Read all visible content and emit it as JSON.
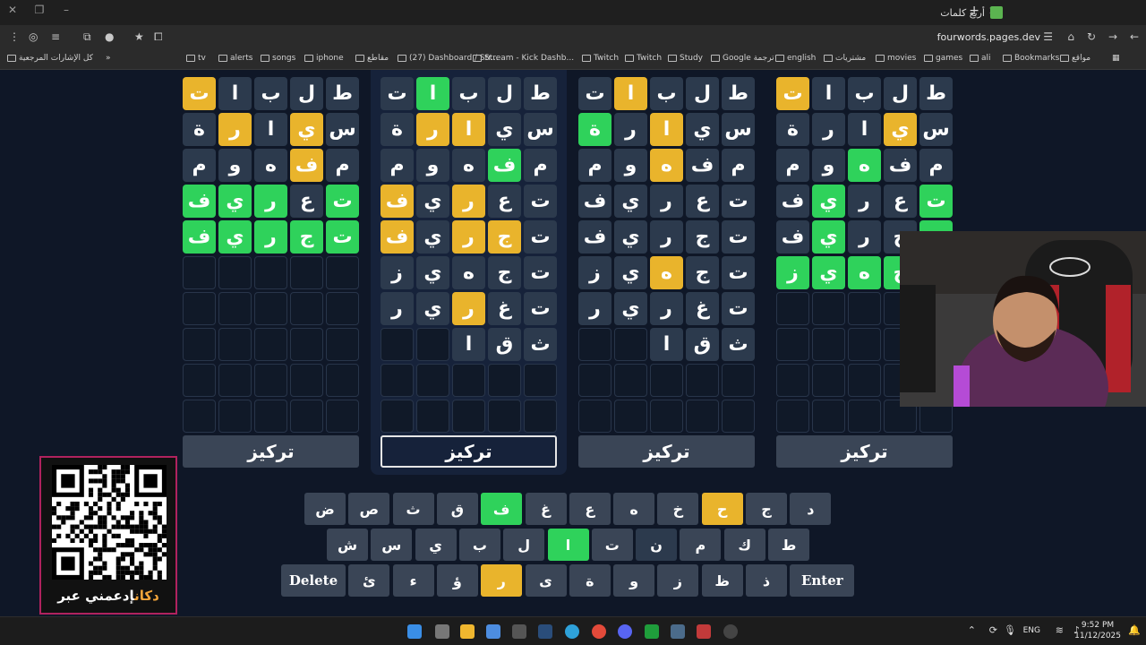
{
  "browser": {
    "tab_title": "أربع كلمات",
    "url": "fourwords.pages.dev",
    "bookmarks": [
      "كل الإشارات المرجعية",
      "tv",
      "alerts",
      "songs",
      "iphone",
      "مقاطع",
      "(27) Dashboard / Str...",
      "Stream - Kick Dashb...",
      "Twitch",
      "Twitch",
      "Study",
      "Google ترجمة",
      "english",
      "مشتريات",
      "movies",
      "games",
      "ali",
      "Bookmarks",
      "مواقع"
    ]
  },
  "boards": [
    {
      "rows": [
        [
          [
            "ت",
            "y"
          ],
          [
            "ا",
            "n"
          ],
          [
            "ب",
            "n"
          ],
          [
            "ل",
            "n"
          ],
          [
            "ط",
            "n"
          ]
        ],
        [
          [
            "ة",
            "n"
          ],
          [
            "ر",
            "y"
          ],
          [
            "ا",
            "n"
          ],
          [
            "ي",
            "y"
          ],
          [
            "س",
            "n"
          ]
        ],
        [
          [
            "م",
            "n"
          ],
          [
            "و",
            "n"
          ],
          [
            "ه",
            "n"
          ],
          [
            "ف",
            "y"
          ],
          [
            "م",
            "n"
          ]
        ],
        [
          [
            "ف",
            "g"
          ],
          [
            "ي",
            "g"
          ],
          [
            "ر",
            "g"
          ],
          [
            "ع",
            "n"
          ],
          [
            "ت",
            "g"
          ]
        ],
        [
          [
            "ف",
            "g"
          ],
          [
            "ي",
            "g"
          ],
          [
            "ر",
            "g"
          ],
          [
            "ج",
            "g"
          ],
          [
            "ت",
            "g"
          ]
        ]
      ],
      "focus_label": "تركيز",
      "active": false
    },
    {
      "rows": [
        [
          [
            "ت",
            "n"
          ],
          [
            "ا",
            "g"
          ],
          [
            "ب",
            "n"
          ],
          [
            "ل",
            "n"
          ],
          [
            "ط",
            "n"
          ]
        ],
        [
          [
            "ة",
            "n"
          ],
          [
            "ر",
            "y"
          ],
          [
            "ا",
            "y"
          ],
          [
            "ي",
            "n"
          ],
          [
            "س",
            "n"
          ]
        ],
        [
          [
            "م",
            "n"
          ],
          [
            "و",
            "n"
          ],
          [
            "ه",
            "n"
          ],
          [
            "ف",
            "g"
          ],
          [
            "م",
            "n"
          ]
        ],
        [
          [
            "ف",
            "y"
          ],
          [
            "ي",
            "n"
          ],
          [
            "ر",
            "y"
          ],
          [
            "ع",
            "n"
          ],
          [
            "ت",
            "n"
          ]
        ],
        [
          [
            "ف",
            "y"
          ],
          [
            "ي",
            "n"
          ],
          [
            "ر",
            "y"
          ],
          [
            "ج",
            "y"
          ],
          [
            "ت",
            "n"
          ]
        ],
        [
          [
            "ز",
            "n"
          ],
          [
            "ي",
            "n"
          ],
          [
            "ه",
            "n"
          ],
          [
            "ج",
            "n"
          ],
          [
            "ت",
            "n"
          ]
        ],
        [
          [
            "ر",
            "n"
          ],
          [
            "ي",
            "n"
          ],
          [
            "ر",
            "y"
          ],
          [
            "غ",
            "n"
          ],
          [
            "ت",
            "n"
          ]
        ],
        [
          [
            "",
            "e"
          ],
          [
            "",
            "e"
          ],
          [
            "ا",
            "n"
          ],
          [
            "ق",
            "n"
          ],
          [
            "ث",
            "n"
          ]
        ]
      ],
      "focus_label": "تركيز",
      "active": true
    },
    {
      "rows": [
        [
          [
            "ت",
            "n"
          ],
          [
            "ا",
            "y"
          ],
          [
            "ب",
            "n"
          ],
          [
            "ل",
            "n"
          ],
          [
            "ط",
            "n"
          ]
        ],
        [
          [
            "ة",
            "g"
          ],
          [
            "ر",
            "n"
          ],
          [
            "ا",
            "y"
          ],
          [
            "ي",
            "n"
          ],
          [
            "س",
            "n"
          ]
        ],
        [
          [
            "م",
            "n"
          ],
          [
            "و",
            "n"
          ],
          [
            "ه",
            "y"
          ],
          [
            "ف",
            "n"
          ],
          [
            "م",
            "n"
          ]
        ],
        [
          [
            "ف",
            "n"
          ],
          [
            "ي",
            "n"
          ],
          [
            "ر",
            "n"
          ],
          [
            "ع",
            "n"
          ],
          [
            "ت",
            "n"
          ]
        ],
        [
          [
            "ف",
            "n"
          ],
          [
            "ي",
            "n"
          ],
          [
            "ر",
            "n"
          ],
          [
            "ج",
            "n"
          ],
          [
            "ت",
            "n"
          ]
        ],
        [
          [
            "ز",
            "n"
          ],
          [
            "ي",
            "n"
          ],
          [
            "ه",
            "y"
          ],
          [
            "ج",
            "n"
          ],
          [
            "ت",
            "n"
          ]
        ],
        [
          [
            "ر",
            "n"
          ],
          [
            "ي",
            "n"
          ],
          [
            "ر",
            "n"
          ],
          [
            "غ",
            "n"
          ],
          [
            "ت",
            "n"
          ]
        ],
        [
          [
            "",
            "e"
          ],
          [
            "",
            "e"
          ],
          [
            "ا",
            "n"
          ],
          [
            "ق",
            "n"
          ],
          [
            "ث",
            "n"
          ]
        ]
      ],
      "focus_label": "تركيز",
      "active": false
    },
    {
      "rows": [
        [
          [
            "ت",
            "y"
          ],
          [
            "ا",
            "n"
          ],
          [
            "ب",
            "n"
          ],
          [
            "ل",
            "n"
          ],
          [
            "ط",
            "n"
          ]
        ],
        [
          [
            "ة",
            "n"
          ],
          [
            "ر",
            "n"
          ],
          [
            "ا",
            "n"
          ],
          [
            "ي",
            "y"
          ],
          [
            "س",
            "n"
          ]
        ],
        [
          [
            "م",
            "n"
          ],
          [
            "و",
            "n"
          ],
          [
            "ه",
            "g"
          ],
          [
            "ف",
            "n"
          ],
          [
            "م",
            "n"
          ]
        ],
        [
          [
            "ف",
            "n"
          ],
          [
            "ي",
            "g"
          ],
          [
            "ر",
            "n"
          ],
          [
            "ع",
            "n"
          ],
          [
            "ت",
            "g"
          ]
        ],
        [
          [
            "ف",
            "n"
          ],
          [
            "ي",
            "g"
          ],
          [
            "ر",
            "n"
          ],
          [
            "ج",
            "n"
          ],
          [
            "ت",
            "g"
          ]
        ],
        [
          [
            "ز",
            "g"
          ],
          [
            "ي",
            "g"
          ],
          [
            "ه",
            "g"
          ],
          [
            "ج",
            "g"
          ],
          [
            "ت",
            "g"
          ]
        ]
      ],
      "focus_label": "تركيز",
      "active": false
    }
  ],
  "keyboard": {
    "row1": [
      [
        "ض",
        "n"
      ],
      [
        "ص",
        "n"
      ],
      [
        "ث",
        "n"
      ],
      [
        "ق",
        "n"
      ],
      [
        "ف",
        "g"
      ],
      [
        "غ",
        "n"
      ],
      [
        "ع",
        "n"
      ],
      [
        "ه",
        "n"
      ],
      [
        "خ",
        "n"
      ],
      [
        "ح",
        "y"
      ],
      [
        "ج",
        "n"
      ],
      [
        "د",
        "n"
      ]
    ],
    "row2": [
      [
        "ش",
        "n"
      ],
      [
        "س",
        "n"
      ],
      [
        "ي",
        "n"
      ],
      [
        "ب",
        "n"
      ],
      [
        "ل",
        "n"
      ],
      [
        "ا",
        "g"
      ],
      [
        "ت",
        "n"
      ],
      [
        "ن",
        "d"
      ],
      [
        "م",
        "n"
      ],
      [
        "ك",
        "n"
      ],
      [
        "ط",
        "n"
      ]
    ],
    "row3": [
      [
        "Delete",
        "w"
      ],
      [
        "ئ",
        "n"
      ],
      [
        "ء",
        "n"
      ],
      [
        "ؤ",
        "n"
      ],
      [
        "ر",
        "y"
      ],
      [
        "ى",
        "n"
      ],
      [
        "ة",
        "n"
      ],
      [
        "و",
        "n"
      ],
      [
        "ز",
        "n"
      ],
      [
        "ظ",
        "n"
      ],
      [
        "ذ",
        "n"
      ],
      [
        "Enter",
        "w"
      ]
    ]
  },
  "qr": {
    "caption_a": "إدعمني عبر",
    "caption_b": "دكان"
  },
  "taskbar": {
    "lang": "ENG",
    "time": "9:52 PM",
    "date": "11/12/2025"
  }
}
